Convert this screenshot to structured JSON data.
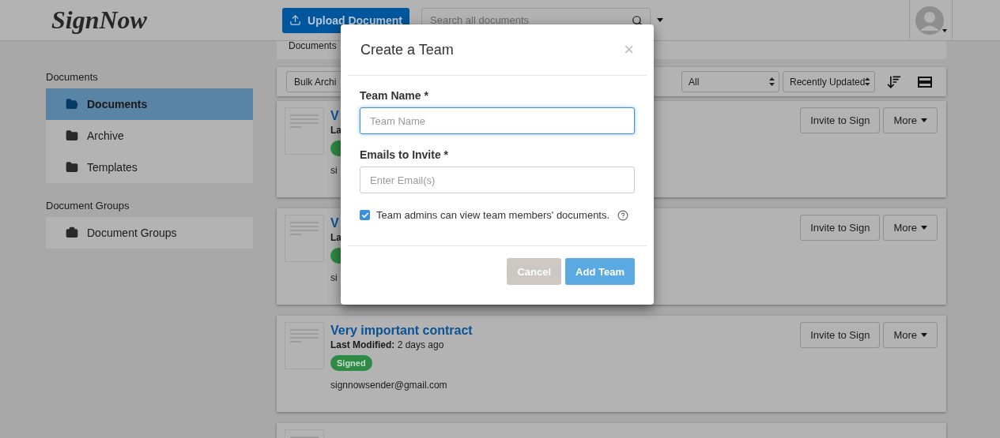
{
  "header": {
    "logo": "SignNow",
    "upload_button": "Upload Document",
    "search": {
      "placeholder": "Search all documents"
    }
  },
  "breadcrumb": "Documents",
  "sidebar": {
    "sections": [
      {
        "heading": "Documents",
        "items": [
          {
            "label": "Documents",
            "selected": true
          },
          {
            "label": "Archive",
            "selected": false
          },
          {
            "label": "Templates",
            "selected": false
          }
        ]
      },
      {
        "heading": "Document Groups",
        "items": [
          {
            "label": "Document Groups",
            "selected": false
          }
        ]
      }
    ]
  },
  "toolbar": {
    "bulk_button": "Bulk Archi",
    "filter": "All",
    "sort": "Recently Updated"
  },
  "documents": [
    {
      "thumbnail": true,
      "title": "V",
      "modified_label": "La",
      "status": {
        "color": "#2e8a44"
      },
      "sender": "si",
      "actions": [
        "Invite to Sign",
        "More"
      ]
    },
    {
      "thumbnail": true,
      "title": "V",
      "modified_label": "La",
      "status": {
        "color": "#2e8a44"
      },
      "sender": "si",
      "actions": [
        "Invite to Sign",
        "More"
      ]
    },
    {
      "thumbnail": true,
      "title": "Very important contract",
      "modified_label": "Last Modified:",
      "modified_value": "2 days ago",
      "status": {
        "label": "Signed",
        "color": "#2e8a44"
      },
      "sender": "signnowsender@gmail.com",
      "actions": [
        "Invite to Sign",
        "More"
      ]
    },
    {
      "thumbnail": true
    }
  ],
  "modal": {
    "title": "Create a Team",
    "close": "×",
    "fields": [
      {
        "label": "Team Name *",
        "placeholder": "Team Name",
        "focused": true
      },
      {
        "label": "Emails to Invite *",
        "placeholder": "Enter Email(s)",
        "focused": false
      }
    ],
    "checkbox": {
      "label": "Team admins can view team members' documents.",
      "checked": true
    },
    "buttons": [
      {
        "label": "Cancel",
        "kind": "secondary"
      },
      {
        "label": "Add Team",
        "kind": "primary"
      }
    ]
  }
}
